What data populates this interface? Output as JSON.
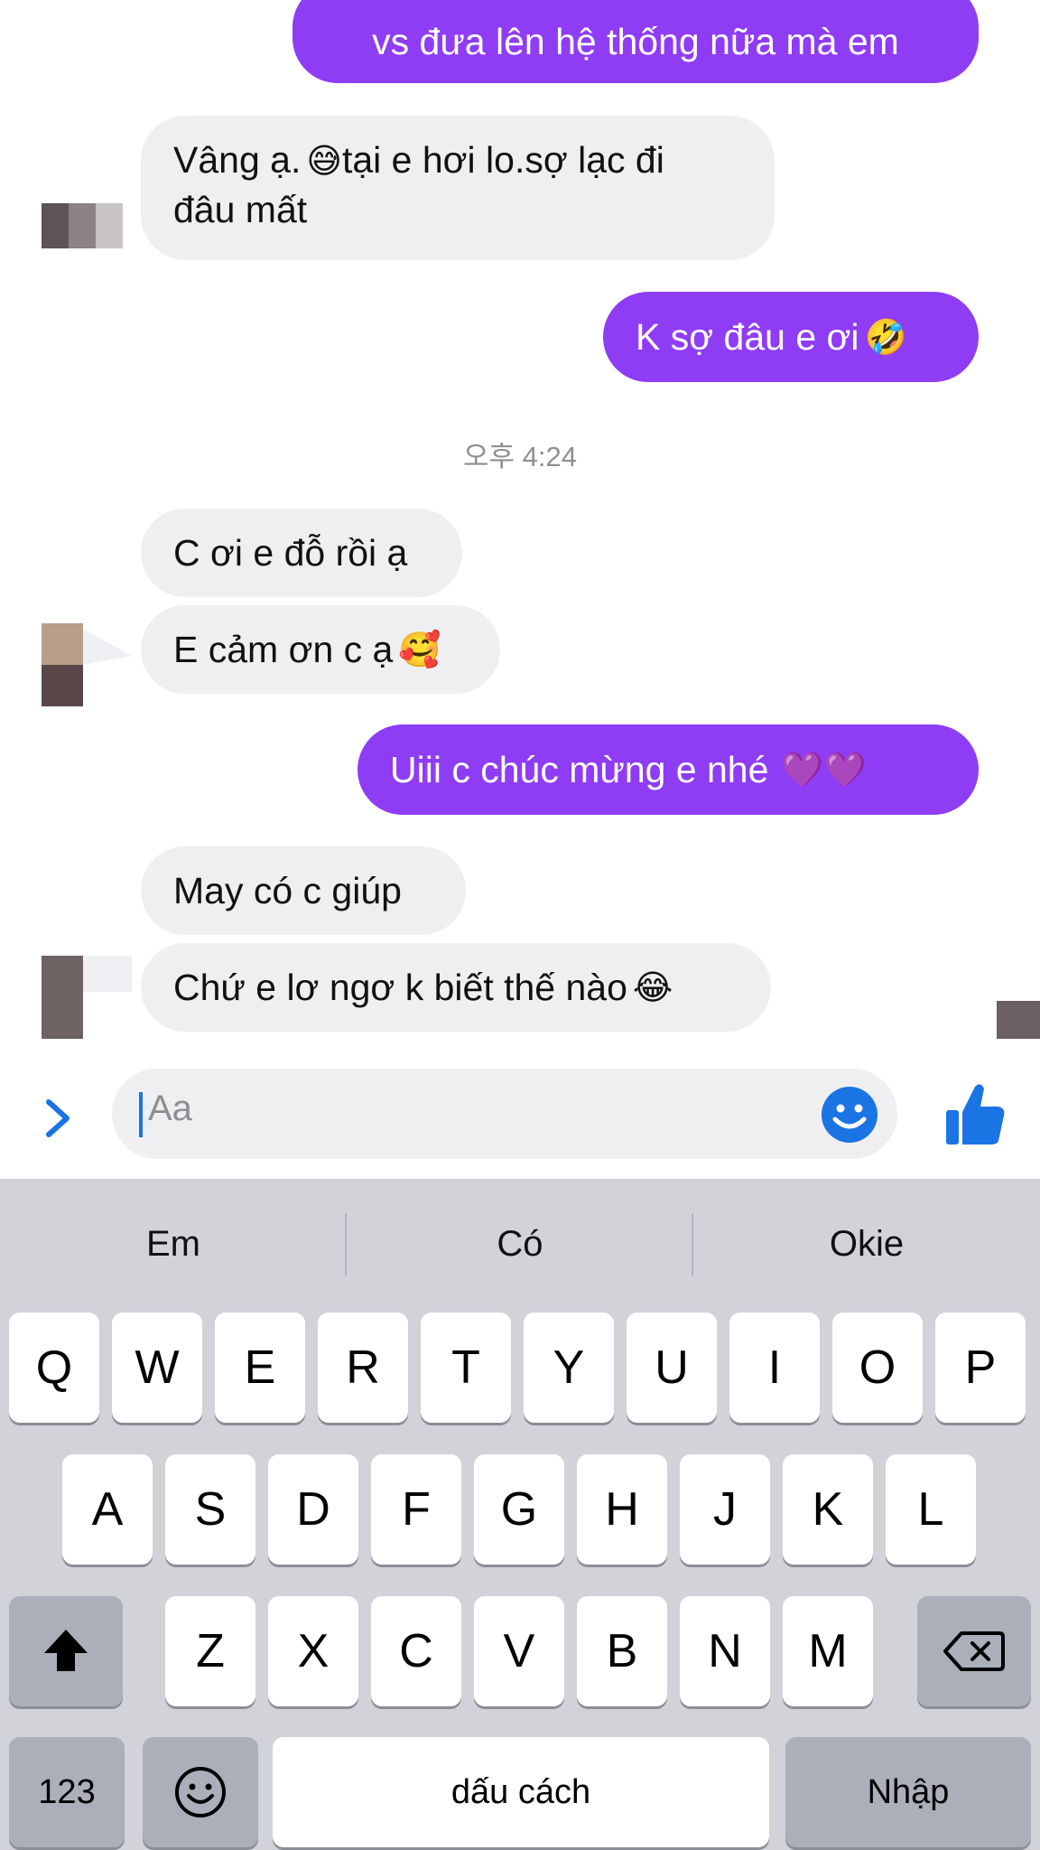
{
  "messages": {
    "m1": "vs đưa lên hệ thống nữa mà em",
    "m2_line1": "Vâng ạ.",
    "m2_emoji": "😅",
    "m2_line1b": "tại e hơi lo.sợ lạc đi",
    "m2_line2": "đâu mất",
    "m3": "K sợ đâu e ơi",
    "m3_emoji": "🤣",
    "timestamp": "오후 4:24",
    "m4": "C ơi e đỗ rồi ạ",
    "m5": "E cảm ơn c ạ",
    "m5_emoji": "🥰",
    "m6": "Uiii c chúc mừng e nhé",
    "m6_emoji": "💜💜",
    "m7": "May có c giúp",
    "m8": "Chứ e lơ ngơ k biết thế nào",
    "m8_emoji": "😂"
  },
  "composer": {
    "placeholder": "Aa",
    "expand_icon": "chevron-right-icon",
    "emoji_icon": "smiley-icon",
    "send_icon": "thumbs-up-icon"
  },
  "keyboard": {
    "suggestions": [
      "Em",
      "Có",
      "Okie"
    ],
    "row1": [
      "Q",
      "W",
      "E",
      "R",
      "T",
      "Y",
      "U",
      "I",
      "O",
      "P"
    ],
    "row2": [
      "A",
      "S",
      "D",
      "F",
      "G",
      "H",
      "J",
      "K",
      "L"
    ],
    "row3": [
      "Z",
      "X",
      "C",
      "V",
      "B",
      "N",
      "M"
    ],
    "numbers_key": "123",
    "space_key": "dấu cách",
    "return_key": "Nhập"
  },
  "colors": {
    "outgoing": "#8f3cf5",
    "incoming": "#efeff1",
    "accent": "#1b74e4",
    "keyboard_bg": "#d1d3d9"
  }
}
